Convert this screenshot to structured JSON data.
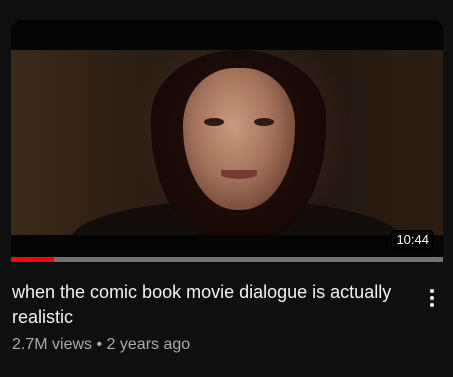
{
  "video": {
    "duration": "10:44",
    "watched_fraction": 0.1,
    "title": "when the comic book movie dialogue is actually realistic",
    "views": "2.7M views",
    "separator": "•",
    "age": "2 years ago"
  },
  "icons": {
    "menu": "more-vert-icon"
  },
  "colors": {
    "background": "#0f0f0f",
    "progress": "#ff0000",
    "title": "#f1f1f1",
    "secondary_text": "#aaaaaa"
  }
}
